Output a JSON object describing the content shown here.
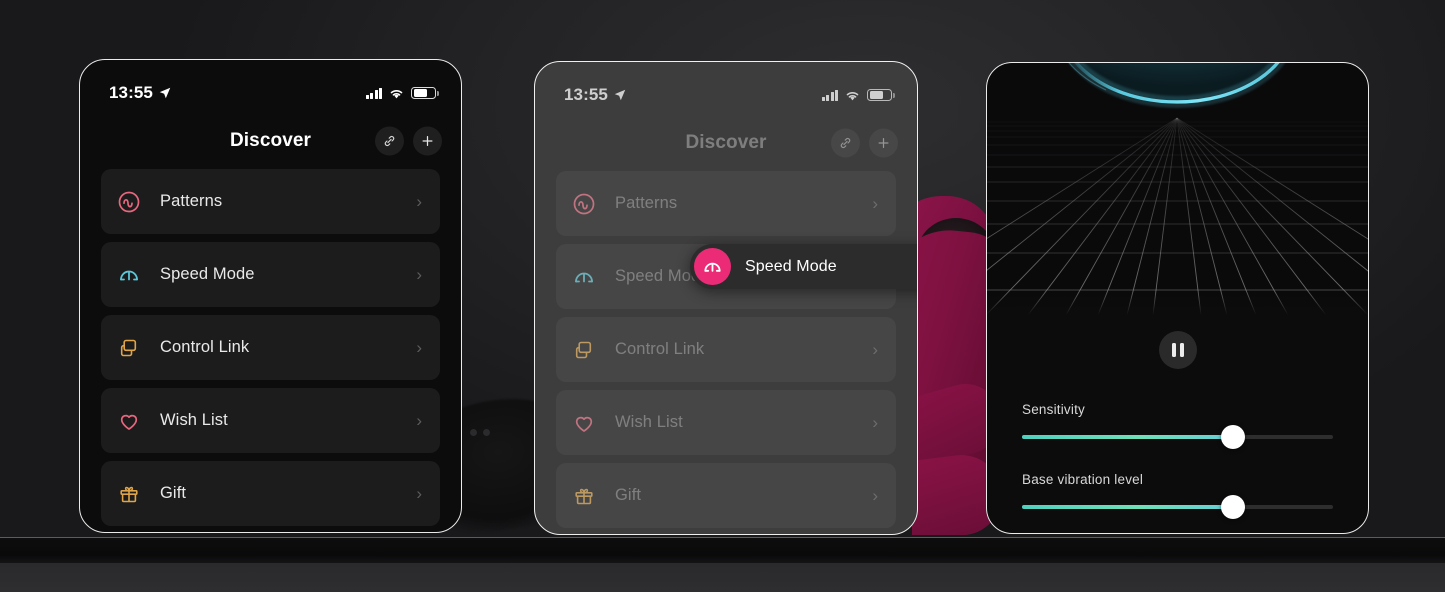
{
  "background": {
    "desk_color": "#232325",
    "product_color": "#7d1140",
    "band_color": "#0b0b0c"
  },
  "statusbar": {
    "time": "13:55",
    "location_icon": "location-arrow-icon",
    "signal_icon": "cellular-signal-icon",
    "wifi_icon": "wifi-icon",
    "battery_icon": "battery-icon"
  },
  "phone1": {
    "nav": {
      "title": "Discover",
      "link_icon": "link-icon",
      "add_icon": "plus-icon"
    },
    "list": [
      {
        "label": "Patterns",
        "icon": "patterns-icon",
        "color": "#e8677f",
        "chevron": "›"
      },
      {
        "label": "Speed Mode",
        "icon": "speed-mode-icon",
        "color": "#5bc8d8",
        "chevron": "›"
      },
      {
        "label": "Control Link",
        "icon": "control-link-icon",
        "color": "#e0a548",
        "chevron": "›"
      },
      {
        "label": "Wish List",
        "icon": "wish-list-icon",
        "color": "#e8677f",
        "chevron": "›"
      },
      {
        "label": "Gift",
        "icon": "gift-icon",
        "color": "#e0a548",
        "chevron": "›"
      }
    ]
  },
  "phone2": {
    "nav": {
      "title": "Discover",
      "link_icon": "link-icon",
      "add_icon": "plus-icon"
    },
    "list": [
      {
        "label": "Patterns",
        "icon": "patterns-icon",
        "color": "#e8677f",
        "chevron": "›"
      },
      {
        "label": "Speed Mode",
        "icon": "speed-mode-icon",
        "color": "#5bc8d8",
        "chevron": "›"
      },
      {
        "label": "Control Link",
        "icon": "control-link-icon",
        "color": "#e0a548",
        "chevron": "›"
      },
      {
        "label": "Wish List",
        "icon": "wish-list-icon",
        "color": "#e8677f",
        "chevron": "›"
      },
      {
        "label": "Gift",
        "icon": "gift-icon",
        "color": "#e0a548",
        "chevron": "›"
      }
    ],
    "toast": {
      "label": "Speed Mode",
      "avatar_icon": "speed-mode-icon",
      "avatar_color": "#ec2b77",
      "close_icon": "close-icon",
      "close_glyph": "✕"
    }
  },
  "phone3": {
    "visualizer": {
      "arc_color": "#5fd8ef",
      "grid_color": "#6b6b6b",
      "name": "perspective-grid-visualizer"
    },
    "pause_button": {
      "icon": "pause-icon"
    },
    "sliders": [
      {
        "label": "Sensitivity",
        "value": 68,
        "fill_color": "#5fd6bd"
      },
      {
        "label": "Base vibration level",
        "value": 68,
        "fill_color": "#5fd6bd"
      }
    ]
  }
}
